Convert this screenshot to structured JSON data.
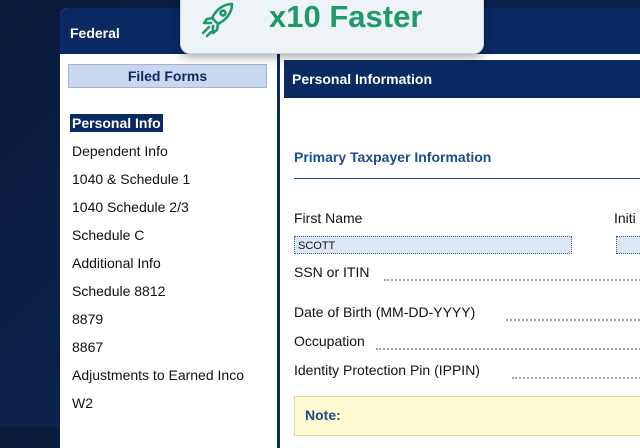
{
  "window": {
    "title": "Federal"
  },
  "badge": {
    "text": "x10 Faster",
    "icon": "rocket-icon",
    "color": "#1e9968"
  },
  "sidebar": {
    "header": "Filed Forms",
    "items": [
      {
        "label": "Personal Info",
        "active": true
      },
      {
        "label": "Dependent Info"
      },
      {
        "label": "1040 & Schedule 1"
      },
      {
        "label": "1040 Schedule 2/3"
      },
      {
        "label": "Schedule C"
      },
      {
        "label": "Additional Info"
      },
      {
        "label": "Schedule 8812"
      },
      {
        "label": "8879"
      },
      {
        "label": "8867"
      },
      {
        "label": "Adjustments to Earned Inco"
      },
      {
        "label": "W2"
      }
    ]
  },
  "main": {
    "header": "Personal Information",
    "section_title": "Primary Taxpayer Information",
    "first_name": {
      "label": "First Name",
      "value": "SCOTT"
    },
    "initial": {
      "label": "Initi"
    },
    "ssn": {
      "label": "SSN or ITIN"
    },
    "dob": {
      "label": "Date of Birth (MM-DD-YYYY)"
    },
    "occupation": {
      "label": "Occupation"
    },
    "ippin": {
      "label": "Identity Protection Pin (IPPIN)"
    },
    "note": {
      "label": "Note:"
    }
  },
  "colors": {
    "navy": "#0b2a63",
    "section_blue": "#1d4d8f",
    "field_bg": "#dde6f5",
    "note_bg": "#fdfbd2"
  }
}
